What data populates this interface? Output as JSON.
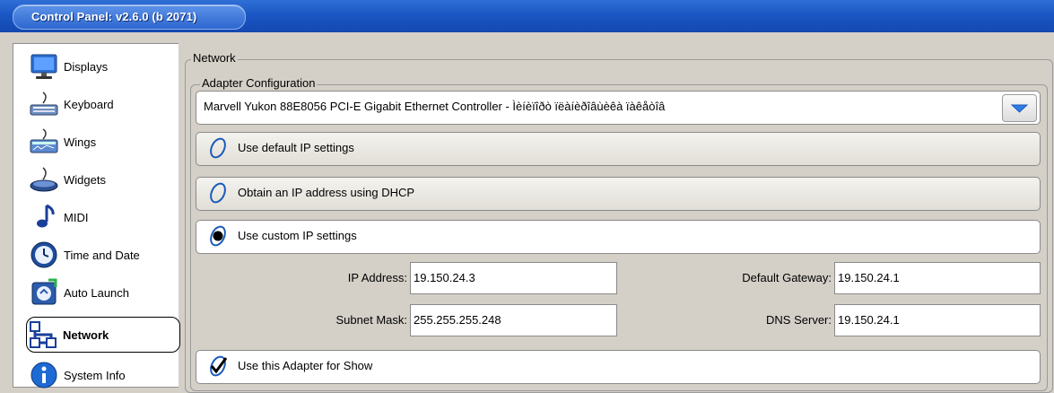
{
  "window": {
    "title": "Control Panel: v2.6.0 (b 2071)"
  },
  "sidebar": {
    "items": [
      {
        "label": "Displays",
        "icon": "monitor-icon"
      },
      {
        "label": "Keyboard",
        "icon": "keyboard-icon"
      },
      {
        "label": "Wings",
        "icon": "wing-icon"
      },
      {
        "label": "Widgets",
        "icon": "widget-icon"
      },
      {
        "label": "MIDI",
        "icon": "music-note-icon"
      },
      {
        "label": "Time and Date",
        "icon": "clock-icon"
      },
      {
        "label": "Auto Launch",
        "icon": "auto-launch-icon"
      },
      {
        "label": "Network",
        "icon": "network-icon",
        "active": true
      },
      {
        "label": "System Info",
        "icon": "info-icon"
      }
    ]
  },
  "network": {
    "group_title": "Network",
    "adapter_group_title": "Adapter Configuration",
    "adapter_select_value": "Marvell Yukon 88E8056 PCI-E Gigabit Ethernet Controller - Ìèíèïîðò ïëàíèðîâùèêà ïàêåòîâ",
    "options": {
      "default_ip": "Use default IP settings",
      "dhcp": "Obtain an IP address using DHCP",
      "custom_ip": "Use custom IP settings",
      "use_for_show": "Use this Adapter for Show"
    },
    "selected_option": "custom_ip",
    "fields": {
      "ip_address_label": "IP Address:",
      "ip_address": "19.150.24.3",
      "subnet_mask_label": "Subnet Mask:",
      "subnet_mask": "255.255.255.248",
      "gateway_label": "Default Gateway:",
      "gateway": "19.150.24.1",
      "dns_label": "DNS Server:",
      "dns": "19.150.24.1"
    }
  },
  "colors": {
    "titlebar": "#1b57c4",
    "background": "#d4d0c8",
    "accent": "#2f6fd6"
  }
}
